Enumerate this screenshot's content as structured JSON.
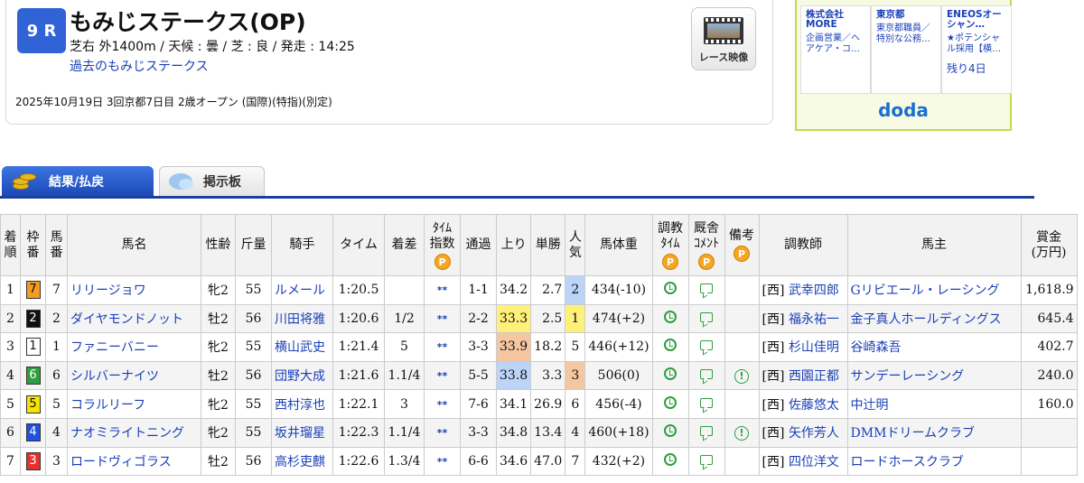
{
  "race": {
    "number": "9 R",
    "title": "もみじステークス(OP)",
    "info": "芝右 外1400m /  天候 : 曇 /  芝 : 良  /  発走 : 14:25",
    "past_link": "過去のもみじステークス",
    "meta": "2025年10月19日 3回京都7日目 2歳オープン  (国際)(特指)(別定)",
    "movie_label": "レース映像"
  },
  "ads": {
    "items": [
      {
        "title": "株式会社MORE",
        "desc": "企画営業／ヘアケア・コ…"
      },
      {
        "title": "東京都",
        "desc": "東京都職員／特別な公務…"
      },
      {
        "title": "ENEOSオーシャン…",
        "desc": "★ポテンシャル採用【横…",
        "days": "残り4日"
      }
    ],
    "logo": "doda"
  },
  "tabs": [
    {
      "label": "結果/払戻"
    },
    {
      "label": "掲示板"
    }
  ],
  "table": {
    "headers": [
      "着\n順",
      "枠\n番",
      "馬\n番",
      "馬名",
      "性齢",
      "斤量",
      "騎手",
      "タイム",
      "着差",
      "ﾀｲﾑ\n指数",
      "通過",
      "上り",
      "単勝",
      "人\n気",
      "馬体重",
      "調教\nﾀｲﾑ",
      "厩舎\nｺﾒﾝﾄ",
      "備考",
      "調教師",
      "馬主",
      "賞金\n(万円)"
    ],
    "point_label": "P",
    "rows": [
      {
        "rank": "1",
        "waku": "7",
        "num": "7",
        "name": "リリージョワ",
        "sex": "牝2",
        "kinryo": "55",
        "jockey": "ルメール",
        "time": "1:20.5",
        "diff": "",
        "index": "**",
        "pass": "1-1",
        "last": "34.2",
        "odds": "2.7",
        "pop": "2",
        "weight": "434(-10)",
        "note": "",
        "trainer_region": "[西]",
        "trainer": "武幸四郎",
        "owner": "Gリビエール・レーシング",
        "prize": "1,618.9"
      },
      {
        "rank": "2",
        "waku": "2",
        "num": "2",
        "name": "ダイヤモンドノット",
        "sex": "牡2",
        "kinryo": "56",
        "jockey": "川田将雅",
        "time": "1:20.6",
        "diff": "1/2",
        "index": "**",
        "pass": "2-2",
        "last": "33.3",
        "odds": "2.5",
        "pop": "1",
        "weight": "474(+2)",
        "note": "",
        "trainer_region": "[西]",
        "trainer": "福永祐一",
        "owner": "金子真人ホールディングス",
        "prize": "645.4"
      },
      {
        "rank": "3",
        "waku": "1",
        "num": "1",
        "name": "ファニーバニー",
        "sex": "牝2",
        "kinryo": "55",
        "jockey": "横山武史",
        "time": "1:21.4",
        "diff": "5",
        "index": "**",
        "pass": "3-3",
        "last": "33.9",
        "odds": "18.2",
        "pop": "5",
        "weight": "446(+12)",
        "note": "",
        "trainer_region": "[西]",
        "trainer": "杉山佳明",
        "owner": "谷崎森吾",
        "prize": "402.7"
      },
      {
        "rank": "4",
        "waku": "6",
        "num": "6",
        "name": "シルバーナイツ",
        "sex": "牡2",
        "kinryo": "56",
        "jockey": "団野大成",
        "time": "1:21.6",
        "diff": "1.1/4",
        "index": "**",
        "pass": "5-5",
        "last": "33.8",
        "odds": "3.3",
        "pop": "3",
        "weight": "506(0)",
        "note": "!",
        "trainer_region": "[西]",
        "trainer": "西園正都",
        "owner": "サンデーレーシング",
        "prize": "240.0"
      },
      {
        "rank": "5",
        "waku": "5",
        "num": "5",
        "name": "コラルリーフ",
        "sex": "牝2",
        "kinryo": "55",
        "jockey": "西村淳也",
        "time": "1:22.1",
        "diff": "3",
        "index": "**",
        "pass": "7-6",
        "last": "34.1",
        "odds": "26.9",
        "pop": "6",
        "weight": "456(-4)",
        "note": "",
        "trainer_region": "[西]",
        "trainer": "佐藤悠太",
        "owner": "中辻明",
        "prize": "160.0"
      },
      {
        "rank": "6",
        "waku": "4",
        "num": "4",
        "name": "ナオミライトニング",
        "sex": "牝2",
        "kinryo": "55",
        "jockey": "坂井瑠星",
        "time": "1:22.3",
        "diff": "1.1/4",
        "index": "**",
        "pass": "3-3",
        "last": "34.8",
        "odds": "13.4",
        "pop": "4",
        "weight": "460(+18)",
        "note": "!",
        "trainer_region": "[西]",
        "trainer": "矢作芳人",
        "owner": "DMMドリームクラブ",
        "prize": ""
      },
      {
        "rank": "7",
        "waku": "3",
        "num": "3",
        "name": "ロードヴィゴラス",
        "sex": "牡2",
        "kinryo": "56",
        "jockey": "高杉吏麒",
        "time": "1:22.6",
        "diff": "1.3/4",
        "index": "**",
        "pass": "6-6",
        "last": "34.6",
        "odds": "47.0",
        "pop": "7",
        "weight": "432(+2)",
        "note": "",
        "trainer_region": "[西]",
        "trainer": "四位洋文",
        "owner": "ロードホースクラブ",
        "prize": ""
      }
    ]
  },
  "colors": {
    "waku": {
      "1": "#ffffff",
      "2": "#111111",
      "3": "#e53030",
      "4": "#2050e0",
      "5": "#f5e400",
      "6": "#2f9e3f",
      "7": "#f59a23",
      "8": "#f5a0c8"
    },
    "waku_text": {
      "1": "#111111",
      "2": "#ffffff",
      "3": "#ffffff",
      "4": "#ffffff",
      "5": "#111111",
      "6": "#ffffff",
      "7": "#111111",
      "8": "#111111"
    }
  },
  "icons": {
    "training": "clock-icon",
    "comment": "speech-bubble-icon",
    "note": "exclamation-circle-icon",
    "movie": "film-icon"
  }
}
